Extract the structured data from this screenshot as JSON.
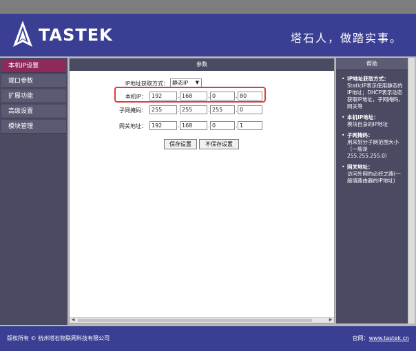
{
  "brand": {
    "logo_text": "TASTEK",
    "slogan": "塔石人，做踏实事。"
  },
  "sidebar": {
    "items": [
      {
        "label": "本机IP设置",
        "active": true
      },
      {
        "label": "端口参数",
        "active": false
      },
      {
        "label": "扩展功能",
        "active": false
      },
      {
        "label": "高级设置",
        "active": false
      },
      {
        "label": "模块管理",
        "active": false
      }
    ]
  },
  "main": {
    "title": "参数",
    "ip_mode_label": "IP地址获取方式：",
    "ip_mode_value": "静态IP",
    "ip_label": "本机IP：",
    "ip": [
      "192",
      "168",
      "0",
      "80"
    ],
    "mask_label": "子网掩码：",
    "mask": [
      "255",
      "255",
      "255",
      "0"
    ],
    "gateway_label": "网关地址：",
    "gateway": [
      "192",
      "168",
      "0",
      "1"
    ],
    "save_button": "保存设置",
    "nosave_button": "不保存设置"
  },
  "help": {
    "title": "帮助",
    "items": [
      {
        "heading": "IP地址获取方式：",
        "text": "StaticIP表示使用静态的IP地址；DHCP表示动态获取IP地址，子网掩码，网关等"
      },
      {
        "heading": "本机IP地址：",
        "text": "模块自身的IP地址"
      },
      {
        "heading": "子网掩码：",
        "text": "用来划分子网范围大小（一般是255.255.255.0）"
      },
      {
        "heading": "网关地址：",
        "text": "访问外网的必经之路(一般填路由器的IP地址)"
      }
    ]
  },
  "footer": {
    "copyright": "版权所有 © 杭州塔石物联网科技有限公司",
    "website_label": "官网：",
    "website": "www.tastek.cn"
  },
  "colors": {
    "header_bg": "#3a3f93",
    "sidebar_bg": "#4a4a63",
    "active_item": "#8e2a5a",
    "highlight": "#e03a3a"
  }
}
